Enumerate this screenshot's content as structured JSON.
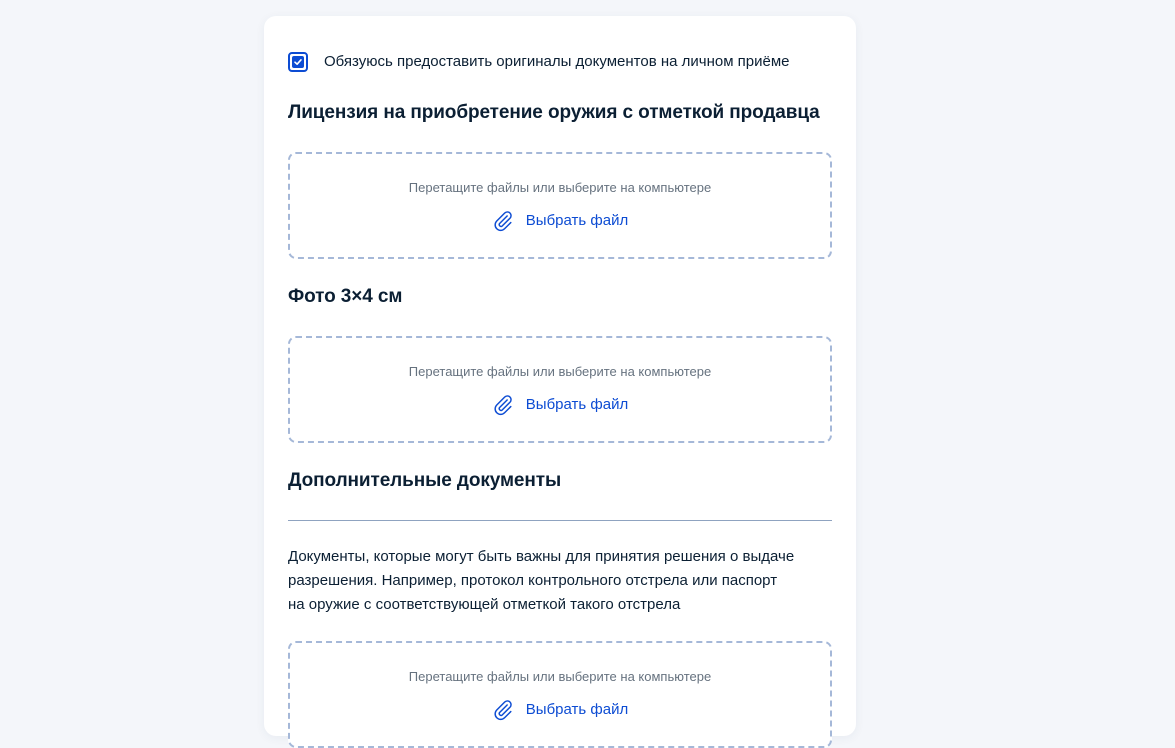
{
  "consent": {
    "checked": true,
    "label": "Обязуюсь предоставить оригиналы документов на личном приёме"
  },
  "sections": [
    {
      "title": "Лицензия на приобретение оружия с отметкой продавца",
      "dropzone": {
        "hint": "Перетащите файлы или выберите на компьютере",
        "button_label": "Выбрать файл",
        "icon": "paperclip-icon"
      }
    },
    {
      "title": "Фото 3×4 см",
      "dropzone": {
        "hint": "Перетащите файлы или выберите на компьютере",
        "button_label": "Выбрать файл",
        "icon": "paperclip-icon"
      }
    },
    {
      "title": "Дополнительные документы",
      "description_lines": [
        "Документы, которые могут быть важны для принятия решения о выдаче",
        "разрешения. Например, протокол контрольного отстрела или паспорт",
        "на оружие с соответствующей отметкой такого отстрела"
      ],
      "dropzone": {
        "hint": "Перетащите файлы или выберите на компьютере",
        "button_label": "Выбрать файл",
        "icon": "paperclip-icon"
      }
    }
  ],
  "colors": {
    "accent": "#0d4cd3",
    "text": "#0b1f33",
    "hint": "#66727f",
    "dropzone_border": "#a5b8d8",
    "page_background": "#f4f6fa"
  }
}
